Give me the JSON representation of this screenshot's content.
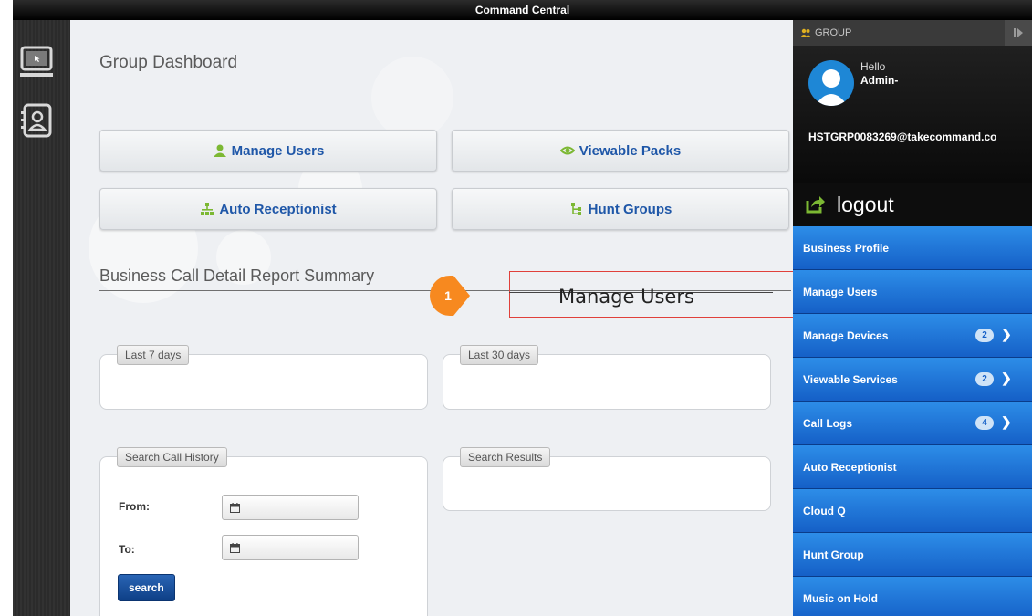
{
  "window": {
    "title": "Command Central"
  },
  "main": {
    "dashboard_title": "Group Dashboard",
    "buttons": {
      "manage_users": "Manage Users",
      "viewable_packs": "Viewable Packs",
      "auto_receptionist": "Auto Receptionist",
      "hunt_groups": "Hunt Groups"
    },
    "report_title": "Business Call Detail Report Summary",
    "panels": {
      "last7": "Last 7 days",
      "last30": "Last 30 days",
      "search_history": "Search Call History",
      "search_results": "Search Results"
    },
    "form": {
      "from_label": "From:",
      "to_label": "To:",
      "search_label": "search"
    }
  },
  "callout": {
    "number": "1",
    "text": "Manage Users"
  },
  "sidebar": {
    "header": "GROUP",
    "hello": "Hello",
    "admin": "Admin-",
    "email": "HSTGRP0083269@takecommand.co",
    "logout": "logout",
    "items": [
      {
        "label": "Business Profile",
        "badge": null
      },
      {
        "label": "Manage Users",
        "badge": null
      },
      {
        "label": "Manage Devices",
        "badge": "2"
      },
      {
        "label": "Viewable Services",
        "badge": "2"
      },
      {
        "label": "Call Logs",
        "badge": "4"
      },
      {
        "label": "Auto Receptionist",
        "badge": null
      },
      {
        "label": "Cloud Q",
        "badge": null
      },
      {
        "label": "Hunt Group",
        "badge": null
      },
      {
        "label": "Music on Hold",
        "badge": null
      }
    ]
  },
  "colors": {
    "accent": "#1f57a8",
    "menu": "#1f75d8",
    "callout": "#f7891f",
    "callout_border": "#e0403a"
  },
  "icons": [
    "desktop-icon",
    "contacts-icon",
    "user-icon",
    "eye-icon",
    "org-chart-icon",
    "hierarchy-icon",
    "calendar-icon",
    "logout-icon",
    "collapse-icon",
    "group-icon",
    "chevron-right-icon"
  ]
}
